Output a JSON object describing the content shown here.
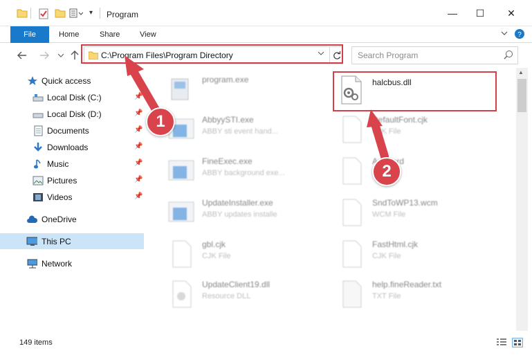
{
  "window": {
    "title": "Program",
    "controls": {
      "minimize": "—",
      "maximize": "☐",
      "close": "✕"
    }
  },
  "ribbon": {
    "tabs": [
      "File",
      "Home",
      "Share",
      "View"
    ],
    "collapse_icon": "chevron-down",
    "help_icon": "help"
  },
  "address": {
    "path": "C:\\Program Files\\Program Directory",
    "search_placeholder": "Search Program"
  },
  "sidebar": {
    "items": [
      {
        "label": "Quick access",
        "icon": "star-icon",
        "pinned": false
      },
      {
        "label": "Local Disk (C:)",
        "icon": "drive-icon",
        "pinned": true
      },
      {
        "label": "Local Disk (D:)",
        "icon": "drive-icon",
        "pinned": true
      },
      {
        "label": "Documents",
        "icon": "documents-icon",
        "pinned": true
      },
      {
        "label": "Downloads",
        "icon": "download-icon",
        "pinned": true
      },
      {
        "label": "Music",
        "icon": "music-icon",
        "pinned": true
      },
      {
        "label": "Pictures",
        "icon": "pictures-icon",
        "pinned": true
      },
      {
        "label": "Videos",
        "icon": "videos-icon",
        "pinned": true
      },
      {
        "label": "OneDrive",
        "icon": "cloud-icon",
        "pinned": false
      },
      {
        "label": "This PC",
        "icon": "computer-icon",
        "pinned": false,
        "selected": true
      },
      {
        "label": "Network",
        "icon": "network-icon",
        "pinned": false
      }
    ]
  },
  "files": {
    "left": [
      {
        "name": "program.exe",
        "type": ""
      },
      {
        "name": "AbbyySTI.exe",
        "type": "ABBY sti event hand..."
      },
      {
        "name": "FineExec.exe",
        "type": "ABBY background exe..."
      },
      {
        "name": "UpdateInstaller.exe",
        "type": "ABBY updates installe"
      },
      {
        "name": "gbl.cjk",
        "type": "CJK File"
      },
      {
        "name": "UpdateClient19.dll",
        "type": "Resource DLL"
      }
    ],
    "right": [
      {
        "name": "halcbus.dll",
        "type": ""
      },
      {
        "name": "DefaultFont.cjk",
        "type": "CJK File"
      },
      {
        "name": "Assword",
        "type": ""
      },
      {
        "name": "SndToWP13.wcm",
        "type": "WCM File"
      },
      {
        "name": "FastHtml.cjk",
        "type": "CJK File"
      },
      {
        "name": "help.fineReader.txt",
        "type": "TXT File"
      }
    ]
  },
  "status": {
    "item_count": "149 items"
  },
  "annotations": {
    "step1": "1",
    "step2": "2"
  },
  "colors": {
    "accent": "#1979ca",
    "highlight": "#d53d48",
    "selected": "#cce4f7"
  }
}
